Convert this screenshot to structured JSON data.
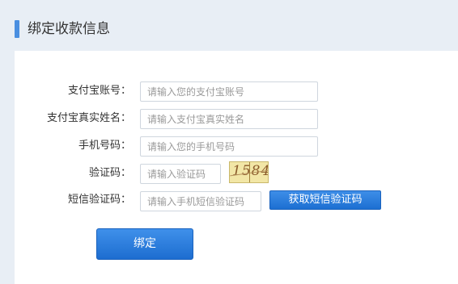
{
  "header": {
    "title": "绑定收款信息"
  },
  "form": {
    "alipay_account": {
      "label": "支付宝账号：",
      "placeholder": "请输入您的支付宝账号"
    },
    "alipay_name": {
      "label": "支付宝真实姓名：",
      "placeholder": "请输入支付宝真实姓名"
    },
    "phone": {
      "label": "手机号码：",
      "placeholder": "请输入您的手机号码"
    },
    "captcha": {
      "label": "验证码：",
      "placeholder": "请输入验证码",
      "image_text": "1584"
    },
    "sms_code": {
      "label": "短信验证码：",
      "placeholder": "请输入手机短信验证码",
      "button_label": "获取短信验证码"
    },
    "submit_label": "绑定"
  },
  "colors": {
    "accent": "#2a7ddc",
    "header_bg": "#e8eef5"
  }
}
